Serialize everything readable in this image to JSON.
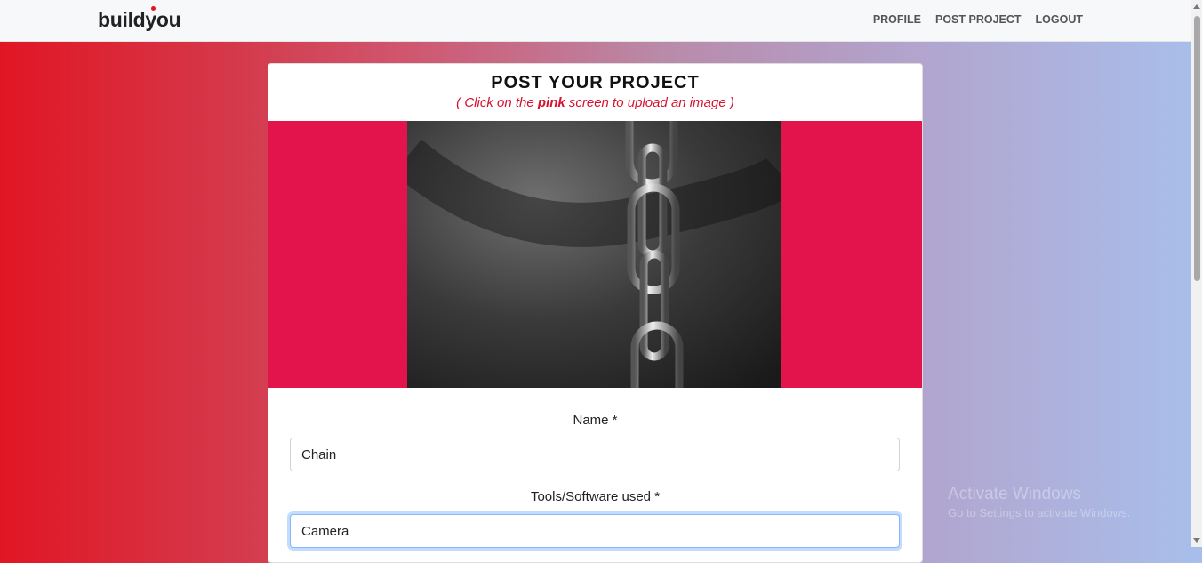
{
  "navbar": {
    "brand": "buildyou",
    "items": [
      "PROFILE",
      "POST PROJECT",
      "LOGOUT"
    ]
  },
  "card": {
    "title": "POST YOUR PROJECT",
    "subtitle_before": "( Click on the ",
    "subtitle_bold": "pink",
    "subtitle_after": " screen to upload an image )",
    "upload_area_color": "#e3144c",
    "image_subject": "chain photo"
  },
  "form": {
    "name_label": "Name *",
    "name_value": "Chain",
    "tools_label": "Tools/Software used *",
    "tools_value": "Camera"
  },
  "watermark": {
    "line1": "Activate Windows",
    "line2": "Go to Settings to activate Windows."
  }
}
